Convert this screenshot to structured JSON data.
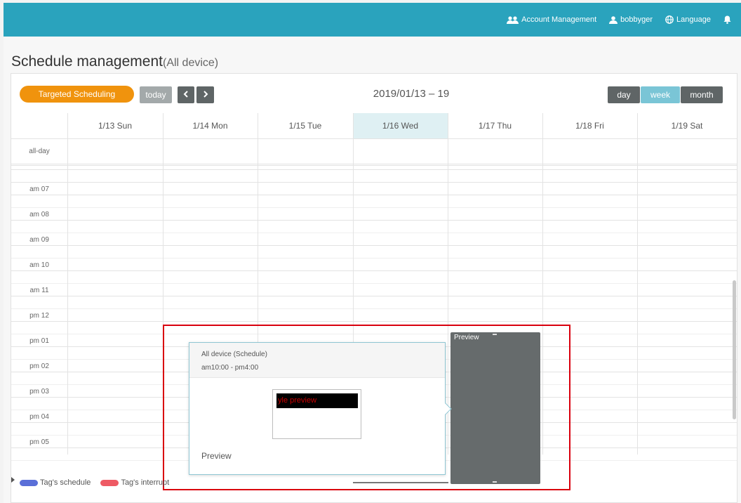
{
  "header": {
    "account_management": "Account Management",
    "username": "bobbyger",
    "language": "Language",
    "brand_color": "#2aa3bd"
  },
  "page": {
    "title": "Schedule management",
    "title_sub": "(All device)"
  },
  "toolbar": {
    "targeted_scheduling": "Targeted Scheduling",
    "today": "today",
    "prev": "<",
    "next": ">",
    "date_range": "2019/01/13 – 19",
    "view_day": "day",
    "view_week": "week",
    "view_month": "month",
    "active_view": "week"
  },
  "calendar": {
    "days": [
      "1/13 Sun",
      "1/14 Mon",
      "1/15 Tue",
      "1/16 Wed",
      "1/17 Thu",
      "1/18 Fri",
      "1/19 Sat"
    ],
    "highlighted_day": "1/16 Wed",
    "all_day_label": "all-day",
    "times": [
      "am 07",
      "am 08",
      "am 09",
      "am 10",
      "am 11",
      "pm 12",
      "pm 01",
      "pm 02",
      "pm 03",
      "pm 04",
      "pm 05"
    ]
  },
  "event": {
    "label": "Preview",
    "day": "1/17 Thu",
    "color": "#666b6c"
  },
  "popover": {
    "title": "All device (Schedule)",
    "time": "am10:00 - pm4:00",
    "thumbnail_text": "yle preview",
    "footer": "Preview"
  },
  "legend": [
    {
      "label": "Tag's schedule",
      "color": "#5a6fd8"
    },
    {
      "label": "Tag's interrupt",
      "color": "#ee5a64"
    }
  ]
}
